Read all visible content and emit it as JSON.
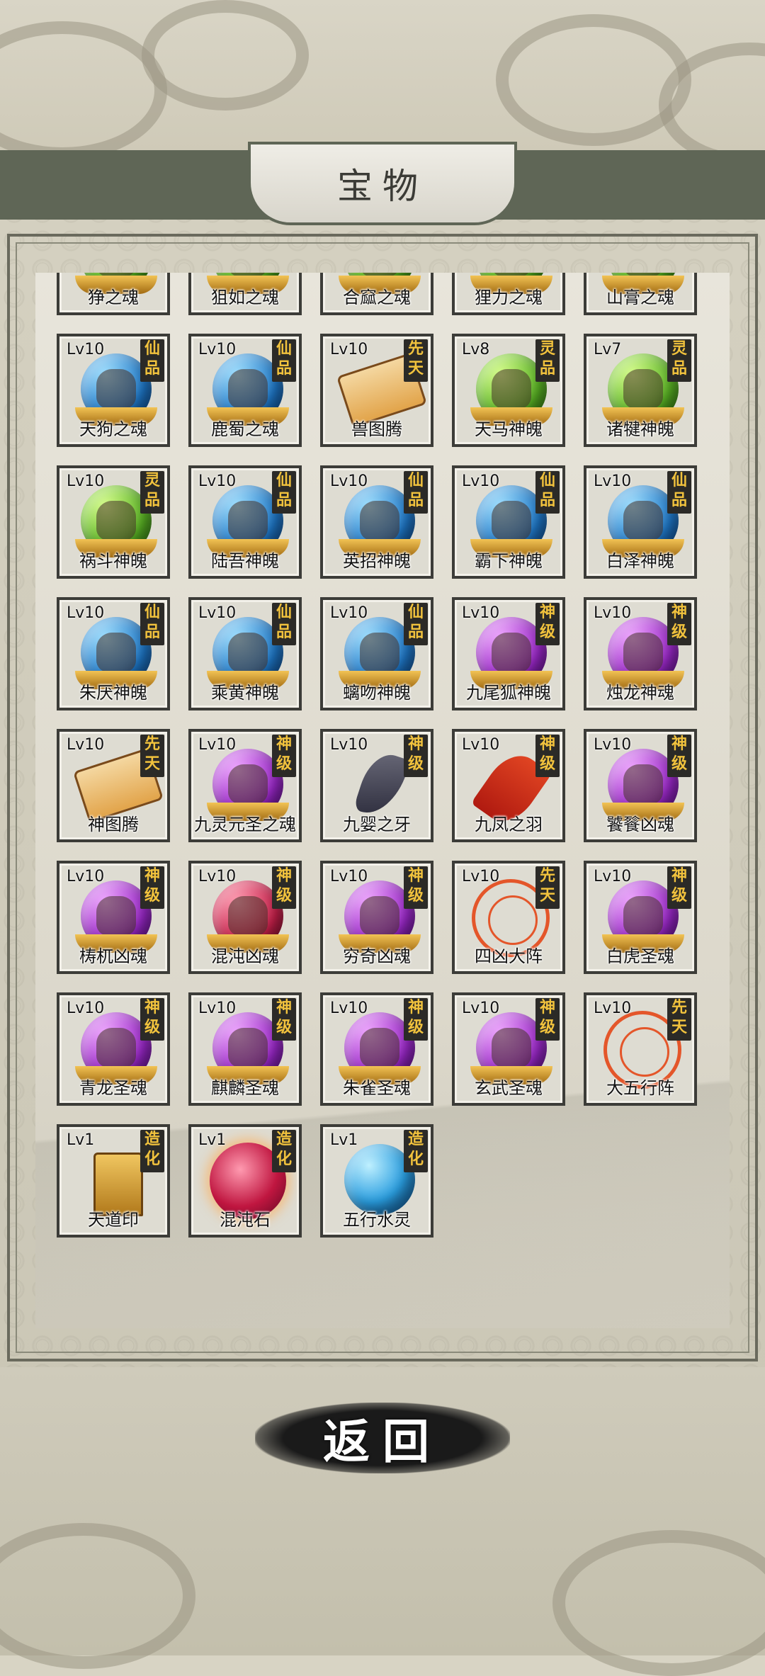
{
  "header": {
    "title": "宝物"
  },
  "footer": {
    "back_label": "返回"
  },
  "items": [
    {
      "lv": "",
      "rank": "",
      "name": "狰之魂",
      "art": "orb-green"
    },
    {
      "lv": "",
      "rank": "",
      "name": "狙如之魂",
      "art": "orb-green"
    },
    {
      "lv": "",
      "rank": "",
      "name": "合窳之魂",
      "art": "orb-green"
    },
    {
      "lv": "",
      "rank": "",
      "name": "狸力之魂",
      "art": "orb-green"
    },
    {
      "lv": "",
      "rank": "",
      "name": "山膏之魂",
      "art": "orb-green"
    },
    {
      "lv": "Lv10",
      "rank": "仙品",
      "name": "天狗之魂",
      "art": "orb-blue"
    },
    {
      "lv": "Lv10",
      "rank": "仙品",
      "name": "鹿蜀之魂",
      "art": "orb-blue"
    },
    {
      "lv": "Lv10",
      "rank": "先天",
      "name": "兽图腾",
      "art": "scroll"
    },
    {
      "lv": "Lv8",
      "rank": "灵品",
      "name": "天马神魄",
      "art": "orb-green"
    },
    {
      "lv": "Lv7",
      "rank": "灵品",
      "name": "诸犍神魄",
      "art": "orb-green"
    },
    {
      "lv": "Lv10",
      "rank": "灵品",
      "name": "祸斗神魄",
      "art": "orb-green"
    },
    {
      "lv": "Lv10",
      "rank": "仙品",
      "name": "陆吾神魄",
      "art": "orb-blue"
    },
    {
      "lv": "Lv10",
      "rank": "仙品",
      "name": "英招神魄",
      "art": "orb-blue"
    },
    {
      "lv": "Lv10",
      "rank": "仙品",
      "name": "霸下神魄",
      "art": "orb-blue"
    },
    {
      "lv": "Lv10",
      "rank": "仙品",
      "name": "白泽神魄",
      "art": "orb-blue"
    },
    {
      "lv": "Lv10",
      "rank": "仙品",
      "name": "朱厌神魄",
      "art": "orb-blue"
    },
    {
      "lv": "Lv10",
      "rank": "仙品",
      "name": "乘黄神魄",
      "art": "orb-blue"
    },
    {
      "lv": "Lv10",
      "rank": "仙品",
      "name": "螭吻神魄",
      "art": "orb-blue"
    },
    {
      "lv": "Lv10",
      "rank": "神级",
      "name": "九尾狐神魄",
      "art": "orb-purple"
    },
    {
      "lv": "Lv10",
      "rank": "神级",
      "name": "烛龙神魂",
      "art": "orb-purple"
    },
    {
      "lv": "Lv10",
      "rank": "先天",
      "name": "神图腾",
      "art": "scroll"
    },
    {
      "lv": "Lv10",
      "rank": "神级",
      "name": "九灵元圣之魂",
      "art": "orb-purple"
    },
    {
      "lv": "Lv10",
      "rank": "神级",
      "name": "九婴之牙",
      "art": "fang"
    },
    {
      "lv": "Lv10",
      "rank": "神级",
      "name": "九凤之羽",
      "art": "feather"
    },
    {
      "lv": "Lv10",
      "rank": "神级",
      "name": "饕餮凶魂",
      "art": "orb-purple"
    },
    {
      "lv": "Lv10",
      "rank": "神级",
      "name": "梼杌凶魂",
      "art": "orb-purple"
    },
    {
      "lv": "Lv10",
      "rank": "神级",
      "name": "混沌凶魂",
      "art": "orb-crimson"
    },
    {
      "lv": "Lv10",
      "rank": "神级",
      "name": "穷奇凶魂",
      "art": "orb-purple"
    },
    {
      "lv": "Lv10",
      "rank": "先天",
      "name": "四凶大阵",
      "art": "array"
    },
    {
      "lv": "Lv10",
      "rank": "神级",
      "name": "白虎圣魂",
      "art": "orb-purple"
    },
    {
      "lv": "Lv10",
      "rank": "神级",
      "name": "青龙圣魂",
      "art": "orb-purple"
    },
    {
      "lv": "Lv10",
      "rank": "神级",
      "name": "麒麟圣魂",
      "art": "orb-purple"
    },
    {
      "lv": "Lv10",
      "rank": "神级",
      "name": "朱雀圣魂",
      "art": "orb-purple"
    },
    {
      "lv": "Lv10",
      "rank": "神级",
      "name": "玄武圣魂",
      "art": "orb-purple"
    },
    {
      "lv": "Lv10",
      "rank": "先天",
      "name": "大五行阵",
      "art": "array"
    },
    {
      "lv": "Lv1",
      "rank": "造化",
      "name": "天道印",
      "art": "seal"
    },
    {
      "lv": "Lv1",
      "rank": "造化",
      "name": "混沌石",
      "art": "swirl"
    },
    {
      "lv": "Lv1",
      "rank": "造化",
      "name": "五行水灵",
      "art": "orb-water"
    }
  ]
}
